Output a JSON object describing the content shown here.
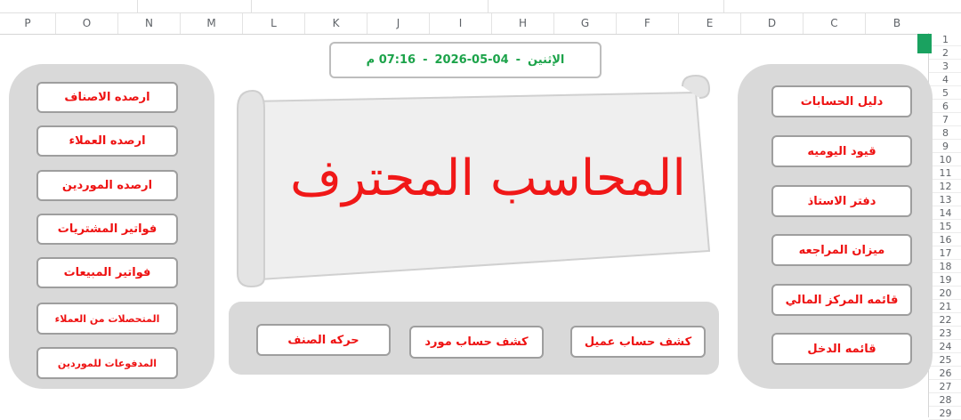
{
  "sheet": {
    "columns": [
      "P",
      "O",
      "N",
      "M",
      "L",
      "K",
      "J",
      "I",
      "H",
      "G",
      "F",
      "E",
      "D",
      "C",
      "B"
    ],
    "rows": [
      "1",
      "2",
      "3",
      "4",
      "5",
      "6",
      "7",
      "8",
      "9",
      "10",
      "11",
      "12",
      "13",
      "14",
      "15",
      "16",
      "17",
      "18",
      "19",
      "20",
      "21",
      "22",
      "23",
      "24",
      "25",
      "26",
      "27",
      "28",
      "29"
    ]
  },
  "header": {
    "day": "الإثنين",
    "date": "2026-05-04",
    "time": "07:16 م"
  },
  "app_title": "المحاسب المحترف",
  "right_menu": [
    "دليل الحسابات",
    "قيود اليوميه",
    "دفتر الاستاذ",
    "ميزان المراجعه",
    "قائمه المركز المالي",
    "قائمه الدخل"
  ],
  "left_menu": [
    "ارصده الاصناف",
    "ارصده العملاء",
    "ارصده الموردين",
    "فواتير المشتريات",
    "فواتير المبيعات",
    "المتحصلات من العملاء",
    "المدفوعات للموردين"
  ],
  "bottom_menu": [
    "كشف حساب عميل",
    "كشف حساب مورد",
    "حركه الصنف"
  ],
  "colors": {
    "accent_red": "#ee1111",
    "accent_green": "#1ca34a",
    "panel_gray": "#d9d9d9",
    "selection_green": "#1aa260"
  }
}
